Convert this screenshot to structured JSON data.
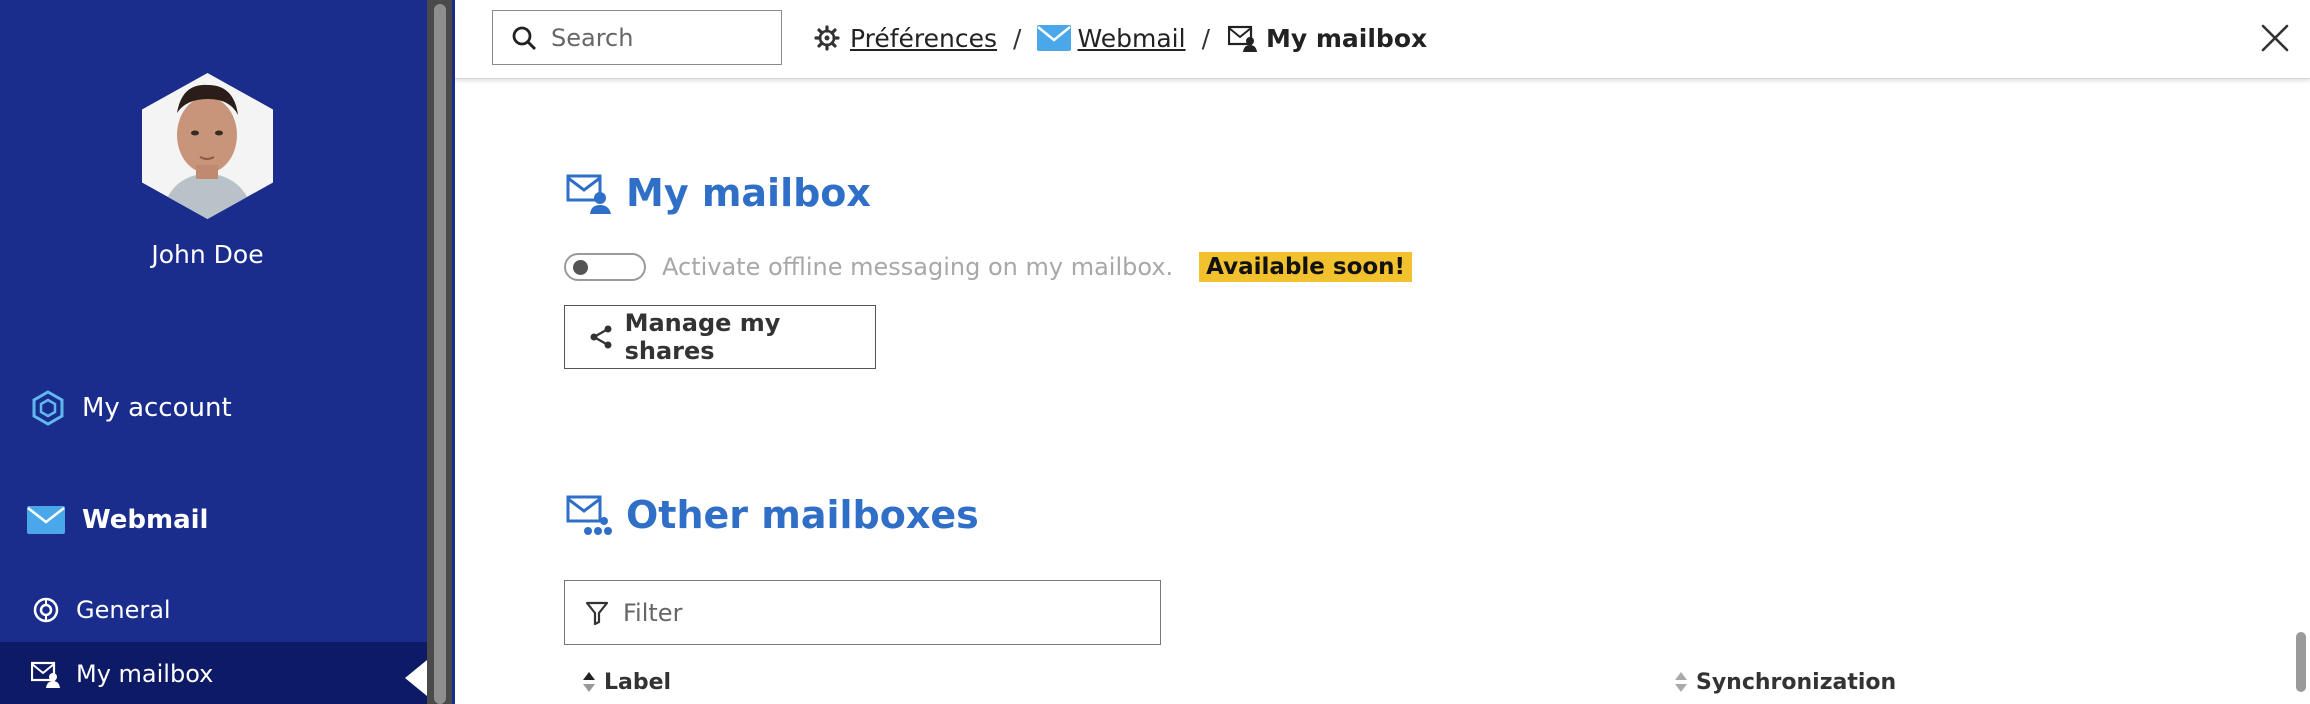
{
  "sidebar": {
    "user_name": "John Doe",
    "items": [
      {
        "label": "My account",
        "icon": "hexagon-network-icon"
      },
      {
        "label": "Webmail",
        "icon": "envelope-icon"
      },
      {
        "label": "General",
        "icon": "settings-circle-icon"
      },
      {
        "label": "My mailbox",
        "icon": "mailbox-user-icon"
      }
    ],
    "active_item": "My mailbox"
  },
  "topbar": {
    "search_placeholder": "Search",
    "breadcrumb": [
      {
        "label": "Préférences",
        "icon": "gear-icon"
      },
      {
        "label": "Webmail",
        "icon": "envelope-icon"
      },
      {
        "label": "My mailbox",
        "icon": "mailbox-user-icon"
      }
    ],
    "separator": "/"
  },
  "main": {
    "my_mailbox": {
      "title": "My mailbox",
      "toggle_label": "Activate offline messaging on my mailbox.",
      "toggle_on": false,
      "badge": "Available soon!",
      "share_button": "Manage my shares"
    },
    "other_mailboxes": {
      "title": "Other mailboxes",
      "filter_placeholder": "Filter",
      "columns": [
        "Label",
        "Synchronization"
      ]
    }
  },
  "colors": {
    "sidebar_bg": "#1b2d8c",
    "sidebar_active_bg": "#0d1a66",
    "accent_blue": "#2f6fc8",
    "badge_yellow": "#f2c12e"
  }
}
